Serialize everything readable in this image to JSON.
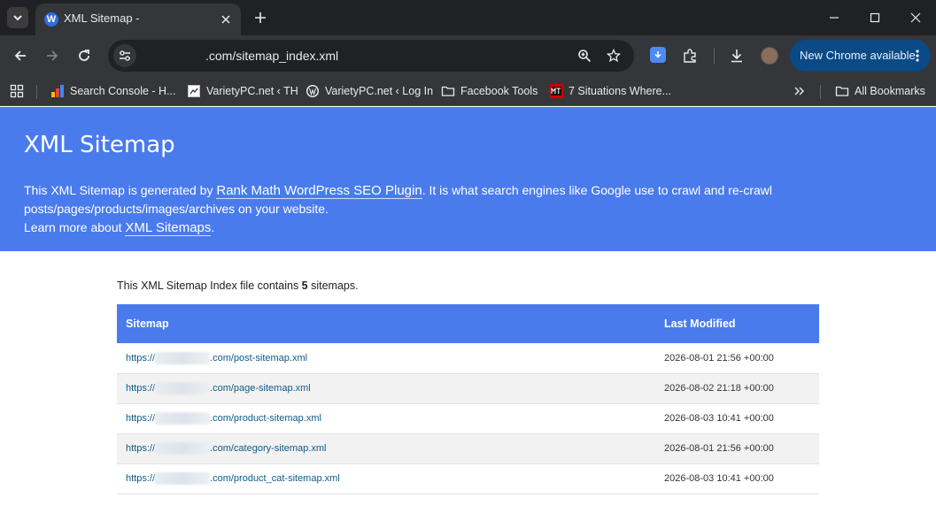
{
  "browser": {
    "tab": {
      "title": "XML Sitemap -"
    },
    "address": {
      "url": ".com/sitemap_index.xml"
    },
    "update_button": {
      "label": "New Chrome available"
    },
    "bookmarks": [
      {
        "label": "Search Console - H..."
      },
      {
        "label": "VarietyPC.net ‹ TH"
      },
      {
        "label": "VarietyPC.net ‹ Log In"
      },
      {
        "label": "Facebook Tools"
      },
      {
        "label": "7 Situations Where..."
      }
    ],
    "all_bookmarks_label": "All Bookmarks",
    "colors": {
      "frame": "#202124",
      "toolbar": "#35363a",
      "update_btn": "#0b4a85"
    }
  },
  "page": {
    "title": "XML Sitemap",
    "description": {
      "prefix": "This XML Sitemap is generated by ",
      "link": "Rank Math WordPress SEO Plugin",
      "suffix": ". It is what search engines like Google use to crawl and re-crawl posts/pages/products/images/archives on your website."
    },
    "learn_more": {
      "prefix": "Learn more about ",
      "link": "XML Sitemaps",
      "suffix": "."
    },
    "intro": {
      "prefix": "This XML Sitemap Index file contains ",
      "count": "5",
      "suffix": " sitemaps."
    },
    "table": {
      "headers": {
        "sitemap": "Sitemap",
        "modified": "Last Modified"
      },
      "rows": [
        {
          "prefix": "https://",
          "suffix": ".com/post-sitemap.xml",
          "modified": "2026-08-01 21:56 +00:00"
        },
        {
          "prefix": "https://",
          "suffix": ".com/page-sitemap.xml",
          "modified": "2026-08-02 21:18 +00:00"
        },
        {
          "prefix": "https://",
          "suffix": ".com/product-sitemap.xml",
          "modified": "2026-08-03 10:41 +00:00"
        },
        {
          "prefix": "https://",
          "suffix": ".com/category-sitemap.xml",
          "modified": "2026-08-01 21:56 +00:00"
        },
        {
          "prefix": "https://",
          "suffix": ".com/product_cat-sitemap.xml",
          "modified": "2026-08-03 10:41 +00:00"
        }
      ]
    },
    "colors": {
      "header_bg": "#4a7bec",
      "link": "#0a5c8a",
      "row_alt": "#f2f2f2"
    }
  }
}
